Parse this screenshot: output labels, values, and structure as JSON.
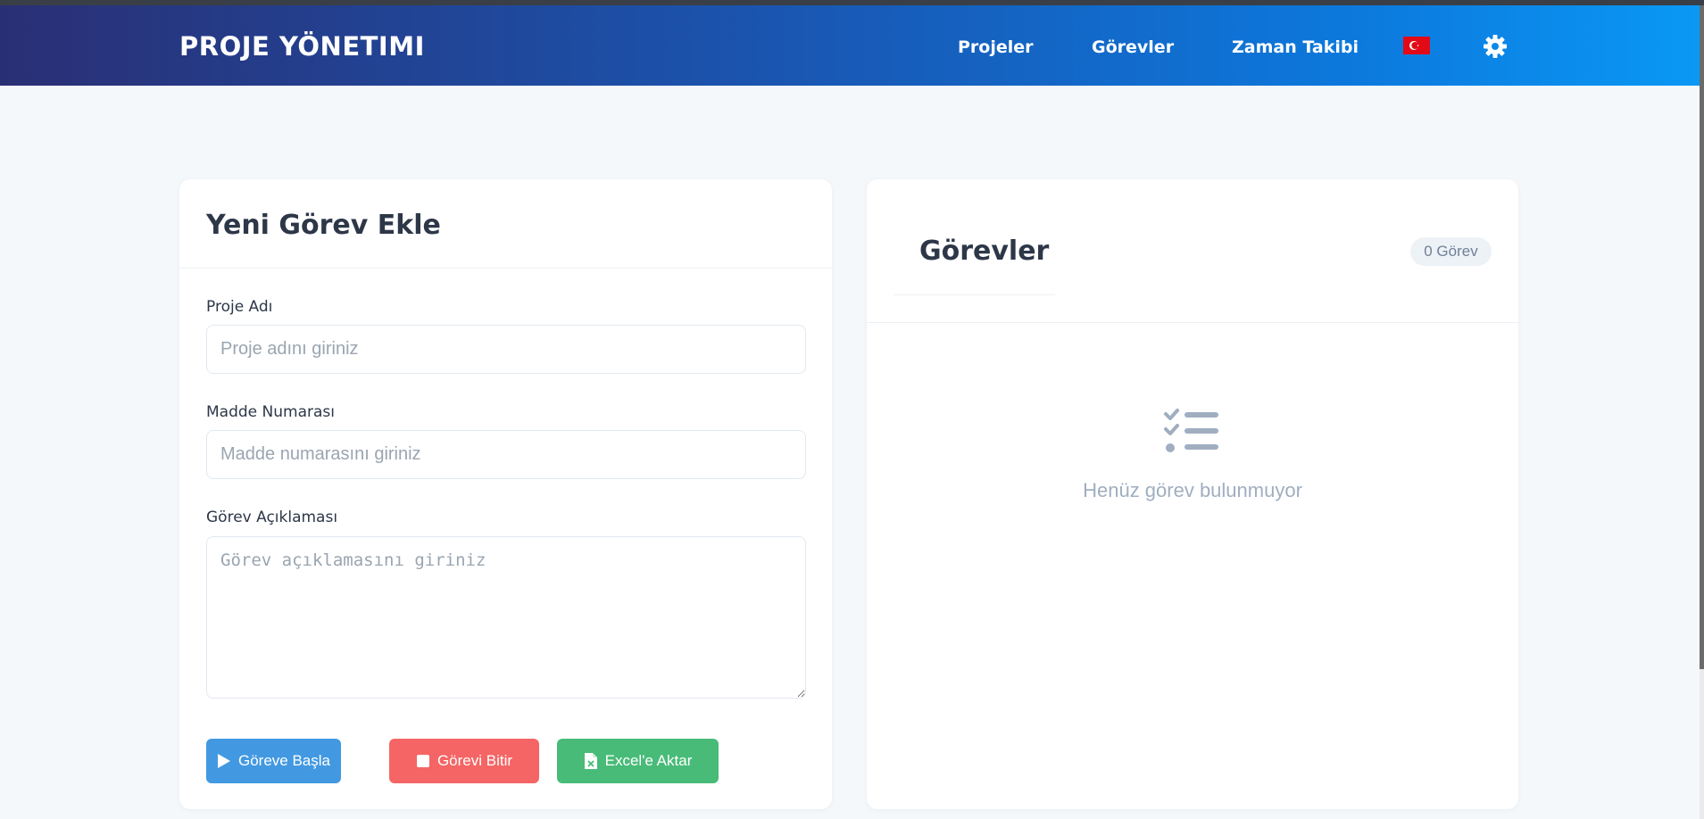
{
  "header": {
    "brand": "PROJE YÖNETIMI",
    "nav": [
      "Projeler",
      "Görevler",
      "Zaman Takibi"
    ],
    "language_icon": "turkey-flag-icon",
    "settings_icon": "gear-icon"
  },
  "form": {
    "title": "Yeni Görev Ekle",
    "project_name": {
      "label": "Proje Adı",
      "placeholder": "Proje adını giriniz",
      "value": ""
    },
    "item_number": {
      "label": "Madde Numarası",
      "placeholder": "Madde numarasını giriniz",
      "value": ""
    },
    "description": {
      "label": "Görev Açıklaması",
      "placeholder": "Görev açıklamasını giriniz",
      "value": ""
    },
    "buttons": {
      "start": "Göreve Başla",
      "stop": "Görevi Bitir",
      "export": "Excel'e Aktar"
    }
  },
  "tasks": {
    "title": "Görevler",
    "count_badge": "0 Görev",
    "empty_text": "Henüz görev bulunmuyor",
    "empty_icon": "task-list-icon"
  },
  "colors": {
    "start_button": "#4299e1",
    "stop_button": "#f56565",
    "export_button": "#48bb78",
    "header_gradient_start": "#2a2f74",
    "header_gradient_end": "#0a98f5"
  }
}
